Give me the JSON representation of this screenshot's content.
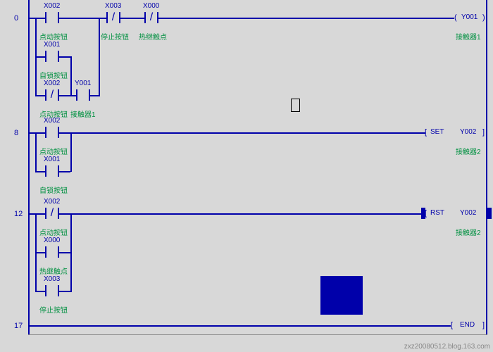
{
  "rungs": {
    "r0": "0",
    "r8": "8",
    "r12": "12",
    "r17": "17"
  },
  "addrs": {
    "x002a": "X002",
    "x003": "X003",
    "x000a": "X000",
    "y001": "Y001",
    "x001a": "X001",
    "x002b": "X002",
    "y001b": "Y001",
    "x002c": "X002",
    "set": "SET",
    "y002a": "Y002",
    "x001b": "X001",
    "x002d": "X002",
    "rst": "RST",
    "y002b": "Y002",
    "x000b": "X000",
    "x003b": "X003",
    "end": "END"
  },
  "labels": {
    "dianxuan1": "点动按钮",
    "tingzhi1": "停止按钮",
    "redong1": "热继触点",
    "jiechu1": "接触器1",
    "zisuo1": "自锁按钮",
    "dianxuan2": "点动按钮",
    "jiechu1b": "接触器1",
    "dianxuan3": "点动按钮",
    "jiechu2": "接触器2",
    "zisuo2": "自锁按钮",
    "dianxuan4": "点动按钮",
    "jiechu2b": "接触器2",
    "redong2": "热继触点",
    "tingzhi2": "停止按钮"
  },
  "watermark": "zxz20080512.blog.163.com"
}
